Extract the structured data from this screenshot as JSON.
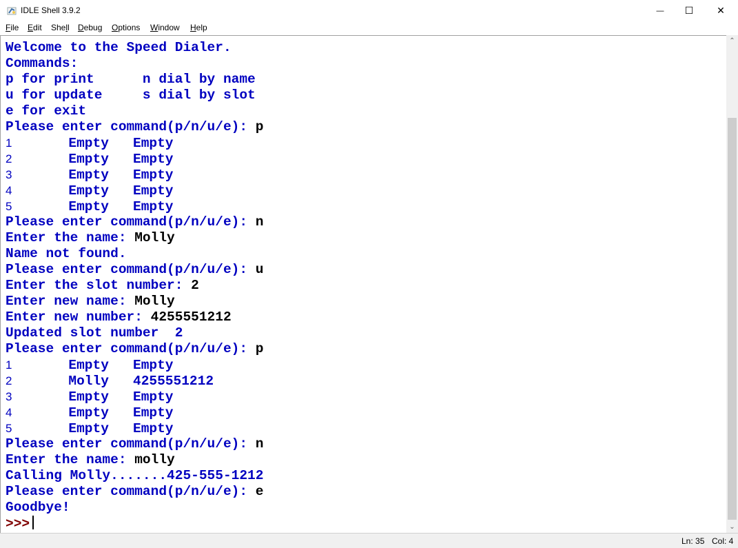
{
  "window": {
    "title": "IDLE Shell 3.9.2",
    "controls": {
      "minimize": "—",
      "maximize": "☐",
      "close": "✕"
    }
  },
  "menu": {
    "items": [
      {
        "label": "File",
        "mnemonic": "F",
        "rest": "ile"
      },
      {
        "label": "Edit",
        "mnemonic": "E",
        "rest": "dit"
      },
      {
        "label": "Shell",
        "pre": "She",
        "mnemonic": "l",
        "rest": "l"
      },
      {
        "label": "Debug",
        "mnemonic": "D",
        "rest": "ebug"
      },
      {
        "label": "Options",
        "mnemonic": "O",
        "rest": "ptions"
      },
      {
        "label": "Window",
        "mnemonic": "W",
        "rest": "indow"
      },
      {
        "label": "Help",
        "mnemonic": "H",
        "rest": "elp"
      }
    ]
  },
  "shell": {
    "lines": [
      {
        "out": "Welcome to the Speed Dialer."
      },
      {
        "out": "Commands:"
      },
      {
        "out": "p for print      n dial by name"
      },
      {
        "out": "u for update     s dial by slot"
      },
      {
        "out": "e for exit"
      },
      {
        "out": "Please enter command(p/n/u/e): ",
        "inp": "p"
      },
      {
        "num": "1",
        "out": "       Empty   Empty"
      },
      {
        "num": "2",
        "out": "       Empty   Empty"
      },
      {
        "num": "3",
        "out": "       Empty   Empty"
      },
      {
        "num": "4",
        "out": "       Empty   Empty"
      },
      {
        "num": "5",
        "out": "       Empty   Empty"
      },
      {
        "out": "Please enter command(p/n/u/e): ",
        "inp": "n"
      },
      {
        "out": "Enter the name: ",
        "inp": "Molly"
      },
      {
        "out": "Name not found."
      },
      {
        "out": "Please enter command(p/n/u/e): ",
        "inp": "u"
      },
      {
        "out": "Enter the slot number: ",
        "inp": "2"
      },
      {
        "out": "Enter new name: ",
        "inp": "Molly"
      },
      {
        "out": "Enter new number: ",
        "inp": "4255551212"
      },
      {
        "out": "Updated slot number  2"
      },
      {
        "out": "Please enter command(p/n/u/e): ",
        "inp": "p"
      },
      {
        "num": "1",
        "out": "       Empty   Empty"
      },
      {
        "num": "2",
        "out": "       Molly   4255551212"
      },
      {
        "num": "3",
        "out": "       Empty   Empty"
      },
      {
        "num": "4",
        "out": "       Empty   Empty"
      },
      {
        "num": "5",
        "out": "       Empty   Empty"
      },
      {
        "out": "Please enter command(p/n/u/e): ",
        "inp": "n"
      },
      {
        "out": "Enter the name: ",
        "inp": "molly"
      },
      {
        "out": "Calling Molly.......425-555-1212"
      },
      {
        "out": "Please enter command(p/n/u/e): ",
        "inp": "e"
      },
      {
        "out": "Goodbye!"
      }
    ],
    "prompt": ">>>"
  },
  "scrollbar": {
    "up_icon": "⌃",
    "down_icon": "⌄"
  },
  "status": {
    "line": "Ln: 35",
    "col": "Col: 4"
  },
  "colors": {
    "output": "#0000c0",
    "input": "#000000",
    "prompt": "#7f0000"
  }
}
